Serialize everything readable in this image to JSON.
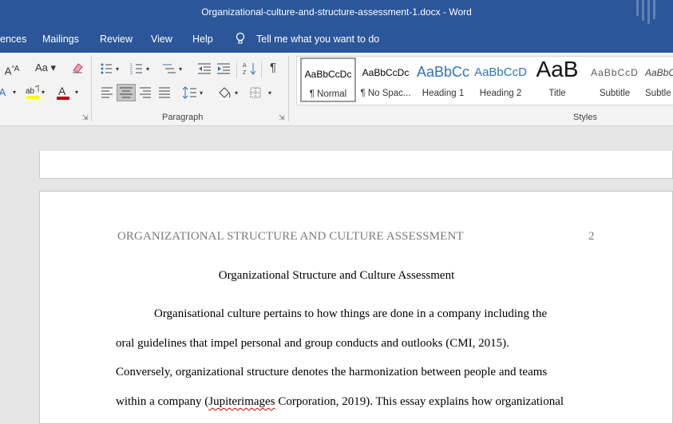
{
  "window": {
    "title": "Organizational-culture-and-structure-assessment-1.docx  -  Word"
  },
  "menu": {
    "references": "ences",
    "mailings": "Mailings",
    "review": "Review",
    "view": "View",
    "help": "Help",
    "tell_me": "Tell me what you want to do"
  },
  "ribbon": {
    "font_group": {
      "change_case": "Aa",
      "grow": "A"
    },
    "paragraph_label": "Paragraph",
    "styles_label": "Styles",
    "styles": [
      {
        "preview": "AaBbCcDc",
        "name": "¶ Normal"
      },
      {
        "preview": "AaBbCcDc",
        "name": "¶ No Spac..."
      },
      {
        "preview": "AaBbCc",
        "name": "Heading 1"
      },
      {
        "preview": "AaBbCcD",
        "name": "Heading 2"
      },
      {
        "preview": "AaB",
        "name": "Title"
      },
      {
        "preview": "AaBbCcD",
        "name": "Subtitle"
      },
      {
        "preview": "AaBbC",
        "name": "Subtle"
      }
    ]
  },
  "document": {
    "header": "ORGANIZATIONAL STRUCTURE AND CULTURE ASSESSMENT",
    "page_number": "2",
    "title": "Organizational Structure and Culture Assessment",
    "lines": [
      "Organisational culture pertains to how things are done in a company including the",
      "oral guidelines that impel personal and group conducts and outlooks (CMI, 2015).",
      "Conversely, organizational structure denotes the harmonization between people and teams"
    ],
    "line4_a": "within a company (",
    "line4_misspelled": "Jupiterimages",
    "line4_b": " Corporation, 2019). This essay explains how organizational"
  },
  "colors": {
    "titlebar": "#2b579a",
    "font_color_red": "#c00000",
    "highlight_yellow": "#ffff00",
    "heading_blue": "#2e74b5"
  }
}
